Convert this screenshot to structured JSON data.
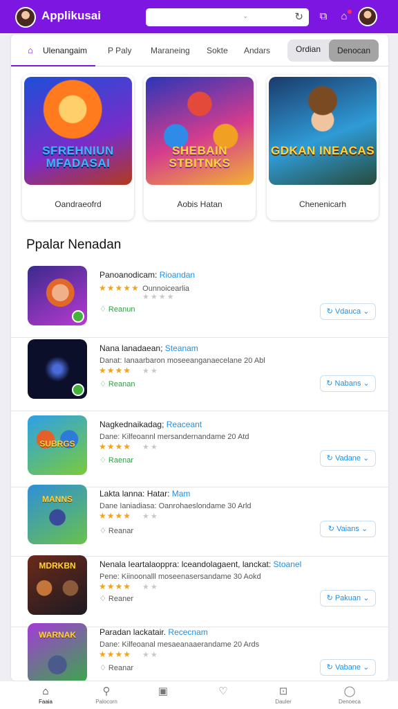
{
  "header": {
    "app_title": "Applikusai",
    "search_chevron": "⌄",
    "refresh_icon": "refresh-icon",
    "share_icon": "share-icon",
    "notifications_icon": "house-notification-icon"
  },
  "tabs": [
    {
      "label": "Ulenangaim",
      "active": true
    },
    {
      "label": "Paly",
      "active": false
    },
    {
      "label": "Maraneing",
      "active": false
    },
    {
      "label": "Sokte",
      "active": false
    },
    {
      "label": "Andars",
      "active": false
    }
  ],
  "segment": {
    "left": "Ordian",
    "right": "Denocan"
  },
  "featured": [
    {
      "art_text": "SFREHNIUN MFADASAI",
      "label": "Oandraeofrd"
    },
    {
      "art_text": "SHEBAIN STBITNKS",
      "label": "Aobis Hatan"
    },
    {
      "art_text": "GDKAN INEACAS",
      "label": "Chenenicarh"
    }
  ],
  "section_title": "Ppalar Nenadan",
  "apps": [
    {
      "title": "Panoanodicam:",
      "title_highlight": "Rioandan",
      "rating_text": "★★★★★",
      "rating_sub": "Ounnoicearlia",
      "description": "",
      "meta": "Reanun",
      "meta_green": true,
      "button": "Vdauca"
    },
    {
      "title": "Nana lanadaean;",
      "title_highlight": "Steanam",
      "rating_text": "★★★★",
      "rating_sub": "",
      "description": "Danat: Ianaarbaron moseeanganaecelane 20 Abl",
      "meta": "Reanan",
      "meta_green": true,
      "button": "Nabans"
    },
    {
      "title": "Nagkednaikadag;",
      "title_highlight": "Reaceant",
      "rating_text": "★★★★",
      "rating_sub": "",
      "description": "Dane: Kilfeoannl mersandernandame 20 Atd",
      "meta": "Raenar",
      "meta_green": true,
      "button": "Vadane"
    },
    {
      "title": "Lakta lanna: Hatar:",
      "title_highlight": "Mam",
      "rating_text": "★★★★",
      "rating_sub": "",
      "description": "Dane Ianiadiasa: Oanrohaeslondame 30 Arld",
      "meta": "Reanar",
      "meta_green": false,
      "button": "Vaians"
    },
    {
      "title": "Nenala Ieartalaoppra: lceandolagaent, lanckat:",
      "title_highlight": "Stoanel",
      "rating_text": "★★★★",
      "rating_sub": "",
      "description": "Pene: Kiinoonalll moseenasersandame 30 Aokd",
      "meta": "Reaner",
      "meta_green": false,
      "button": "Pakuan"
    },
    {
      "title": "Paradan lackatair.",
      "title_highlight": "Rececnam",
      "rating_text": "★★★★",
      "rating_sub": "",
      "description": "Dane: Kilfeoanal mesaeanaaerandame 20 Ards",
      "meta": "Reanar",
      "meta_green": false,
      "button": "Vabane"
    }
  ],
  "bottom_nav": [
    {
      "label": "Faaia",
      "icon": "home-icon",
      "active": true
    },
    {
      "label": "Palocorn",
      "icon": "pin-icon",
      "active": false
    },
    {
      "label": "",
      "icon": "gallery-icon",
      "active": false
    },
    {
      "label": "",
      "icon": "heart-icon",
      "active": false
    },
    {
      "label": "Dauler",
      "icon": "inbox-icon",
      "active": false
    },
    {
      "label": "Denoeca",
      "icon": "profile-icon",
      "active": false
    }
  ],
  "colors": {
    "brand": "#7c16e0",
    "link": "#1d8fe4",
    "star": "#f2a21b",
    "ok": "#2e9e41"
  }
}
